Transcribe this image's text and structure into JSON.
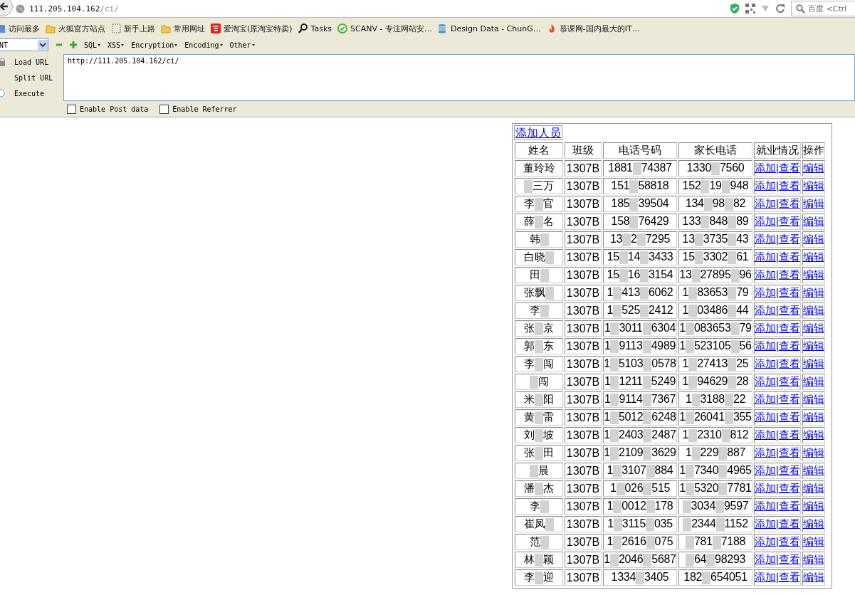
{
  "address_bar": {
    "host": "111.205.104.162",
    "path": "/ci/"
  },
  "search": {
    "placeholder": "百度 <Ctrl"
  },
  "bookmarks": [
    {
      "kind": "grid",
      "label": "访问最多"
    },
    {
      "kind": "folder",
      "label": "火狐官方站点"
    },
    {
      "kind": "dashed",
      "label": "新手上路"
    },
    {
      "kind": "folder",
      "label": "常用网址"
    },
    {
      "kind": "shop",
      "label": "爱淘宝(原淘宝特卖)"
    },
    {
      "kind": "magnifier",
      "label": "Tasks"
    },
    {
      "kind": "check",
      "label": "SCANV - 专注网站安…"
    },
    {
      "kind": "database",
      "label": "Design Data - ChunG…"
    },
    {
      "kind": "flame",
      "label": "慕课网-国内最大的IT…"
    }
  ],
  "hackbar": {
    "select_value": "NT",
    "menus": [
      "SQL",
      "XSS",
      "Encryption",
      "Encoding",
      "Other"
    ],
    "actions": [
      {
        "kind": "lock",
        "label": "Load URL"
      },
      {
        "kind": "plain",
        "label": "Split URL"
      },
      {
        "kind": "circle",
        "label": "Execute"
      }
    ],
    "url_value": "http://111.205.104.162/ci/",
    "options": [
      {
        "label": "Enable Post data",
        "checked": false
      },
      {
        "label": "Enable Referrer",
        "checked": false
      }
    ]
  },
  "page": {
    "add_link": "添加人员",
    "columns": [
      "姓名",
      "班级",
      "电话号码",
      "家长电话",
      "就业情况",
      "操作"
    ],
    "rows": [
      {
        "name": [
          {
            "kind": "text",
            "text": "董玲玲"
          }
        ],
        "class": "1307B",
        "phone": [
          {
            "kind": "text",
            "text": "1881"
          },
          {
            "kind": "mask"
          },
          {
            "kind": "text",
            "text": "74387"
          }
        ],
        "parent_phone": [
          {
            "kind": "text",
            "text": "1330"
          },
          {
            "kind": "mask"
          },
          {
            "kind": "text",
            "text": "7560"
          }
        ],
        "actions": [
          "添加",
          "|",
          "查看"
        ],
        "edit": "编辑"
      },
      {
        "name": [
          {
            "kind": "mask"
          },
          {
            "kind": "text",
            "text": "三万"
          }
        ],
        "class": "1307B",
        "phone": [
          {
            "kind": "text",
            "text": "151"
          },
          {
            "kind": "mask"
          },
          {
            "kind": "text",
            "text": "58818"
          }
        ],
        "parent_phone": [
          {
            "kind": "text",
            "text": "152"
          },
          {
            "kind": "mask"
          },
          {
            "kind": "text",
            "text": "19"
          },
          {
            "kind": "mask"
          },
          {
            "kind": "text",
            "text": "948"
          }
        ],
        "actions": [
          "添加",
          "|",
          "查看"
        ],
        "edit": "编辑"
      },
      {
        "name": [
          {
            "kind": "text",
            "text": "李"
          },
          {
            "kind": "mask"
          },
          {
            "kind": "text",
            "text": "官"
          }
        ],
        "class": "1307B",
        "phone": [
          {
            "kind": "text",
            "text": "185"
          },
          {
            "kind": "mask"
          },
          {
            "kind": "text",
            "text": "39504"
          }
        ],
        "parent_phone": [
          {
            "kind": "text",
            "text": "134"
          },
          {
            "kind": "mask"
          },
          {
            "kind": "text",
            "text": "98"
          },
          {
            "kind": "mask"
          },
          {
            "kind": "text",
            "text": "82"
          }
        ],
        "actions": [
          "添加",
          "|",
          "查看"
        ],
        "edit": "编辑"
      },
      {
        "name": [
          {
            "kind": "text",
            "text": "薛"
          },
          {
            "kind": "mask"
          },
          {
            "kind": "text",
            "text": "名"
          }
        ],
        "class": "1307B",
        "phone": [
          {
            "kind": "text",
            "text": "158"
          },
          {
            "kind": "mask"
          },
          {
            "kind": "text",
            "text": "76429"
          }
        ],
        "parent_phone": [
          {
            "kind": "text",
            "text": "133"
          },
          {
            "kind": "mask"
          },
          {
            "kind": "text",
            "text": "848"
          },
          {
            "kind": "mask"
          },
          {
            "kind": "text",
            "text": "89"
          }
        ],
        "actions": [
          "添加",
          "|",
          "查看"
        ],
        "edit": "编辑"
      },
      {
        "name": [
          {
            "kind": "text",
            "text": "韩"
          },
          {
            "kind": "mask"
          }
        ],
        "class": "1307B",
        "phone": [
          {
            "kind": "text",
            "text": "13"
          },
          {
            "kind": "mask"
          },
          {
            "kind": "text",
            "text": "2"
          },
          {
            "kind": "mask"
          },
          {
            "kind": "text",
            "text": "7295"
          }
        ],
        "parent_phone": [
          {
            "kind": "text",
            "text": "13"
          },
          {
            "kind": "mask"
          },
          {
            "kind": "text",
            "text": "3735"
          },
          {
            "kind": "mask"
          },
          {
            "kind": "text",
            "text": "43"
          }
        ],
        "actions": [
          "添加",
          "|",
          "查看"
        ],
        "edit": "编辑"
      },
      {
        "name": [
          {
            "kind": "text",
            "text": "白晓"
          },
          {
            "kind": "mask"
          }
        ],
        "class": "1307B",
        "phone": [
          {
            "kind": "text",
            "text": "15"
          },
          {
            "kind": "mask"
          },
          {
            "kind": "text",
            "text": "14"
          },
          {
            "kind": "mask"
          },
          {
            "kind": "text",
            "text": "3433"
          }
        ],
        "parent_phone": [
          {
            "kind": "text",
            "text": "15"
          },
          {
            "kind": "mask"
          },
          {
            "kind": "text",
            "text": "3302"
          },
          {
            "kind": "mask"
          },
          {
            "kind": "text",
            "text": "61"
          }
        ],
        "actions": [
          "添加",
          "|",
          "查看"
        ],
        "edit": "编辑"
      },
      {
        "name": [
          {
            "kind": "text",
            "text": "田"
          },
          {
            "kind": "mask"
          }
        ],
        "class": "1307B",
        "phone": [
          {
            "kind": "text",
            "text": "15"
          },
          {
            "kind": "mask"
          },
          {
            "kind": "text",
            "text": "16"
          },
          {
            "kind": "mask"
          },
          {
            "kind": "text",
            "text": "3154"
          }
        ],
        "parent_phone": [
          {
            "kind": "text",
            "text": "13"
          },
          {
            "kind": "mask"
          },
          {
            "kind": "text",
            "text": "27895"
          },
          {
            "kind": "mask"
          },
          {
            "kind": "text",
            "text": "96"
          }
        ],
        "actions": [
          "添加",
          "|",
          "查看"
        ],
        "edit": "编辑"
      },
      {
        "name": [
          {
            "kind": "text",
            "text": "张飘"
          },
          {
            "kind": "mask"
          }
        ],
        "class": "1307B",
        "phone": [
          {
            "kind": "text",
            "text": "1"
          },
          {
            "kind": "mask"
          },
          {
            "kind": "text",
            "text": "413"
          },
          {
            "kind": "mask"
          },
          {
            "kind": "text",
            "text": "6062"
          }
        ],
        "parent_phone": [
          {
            "kind": "text",
            "text": "1"
          },
          {
            "kind": "mask"
          },
          {
            "kind": "text",
            "text": "83653"
          },
          {
            "kind": "mask"
          },
          {
            "kind": "text",
            "text": "79"
          }
        ],
        "actions": [
          "添加",
          "|",
          "查看"
        ],
        "edit": "编辑"
      },
      {
        "name": [
          {
            "kind": "text",
            "text": "李"
          },
          {
            "kind": "mask"
          }
        ],
        "class": "1307B",
        "phone": [
          {
            "kind": "text",
            "text": "1"
          },
          {
            "kind": "mask"
          },
          {
            "kind": "text",
            "text": "525"
          },
          {
            "kind": "mask"
          },
          {
            "kind": "text",
            "text": "2412"
          }
        ],
        "parent_phone": [
          {
            "kind": "text",
            "text": "1"
          },
          {
            "kind": "mask"
          },
          {
            "kind": "text",
            "text": "03486"
          },
          {
            "kind": "mask"
          },
          {
            "kind": "text",
            "text": "44"
          }
        ],
        "actions": [
          "添加",
          "|",
          "查看"
        ],
        "edit": "编辑"
      },
      {
        "name": [
          {
            "kind": "text",
            "text": "张"
          },
          {
            "kind": "mask"
          },
          {
            "kind": "text",
            "text": "京"
          }
        ],
        "class": "1307B",
        "phone": [
          {
            "kind": "text",
            "text": "1"
          },
          {
            "kind": "mask"
          },
          {
            "kind": "text",
            "text": "3011"
          },
          {
            "kind": "mask"
          },
          {
            "kind": "text",
            "text": "6304"
          }
        ],
        "parent_phone": [
          {
            "kind": "text",
            "text": "1"
          },
          {
            "kind": "mask"
          },
          {
            "kind": "text",
            "text": "083653"
          },
          {
            "kind": "mask"
          },
          {
            "kind": "text",
            "text": "79"
          }
        ],
        "actions": [
          "添加",
          "|",
          "查看"
        ],
        "edit": "编辑"
      },
      {
        "name": [
          {
            "kind": "text",
            "text": "郭"
          },
          {
            "kind": "mask"
          },
          {
            "kind": "text",
            "text": "东"
          }
        ],
        "class": "1307B",
        "phone": [
          {
            "kind": "text",
            "text": "1"
          },
          {
            "kind": "mask"
          },
          {
            "kind": "text",
            "text": "9113"
          },
          {
            "kind": "mask"
          },
          {
            "kind": "text",
            "text": "4989"
          }
        ],
        "parent_phone": [
          {
            "kind": "text",
            "text": "1"
          },
          {
            "kind": "mask"
          },
          {
            "kind": "text",
            "text": "523105"
          },
          {
            "kind": "mask"
          },
          {
            "kind": "text",
            "text": "56"
          }
        ],
        "actions": [
          "添加",
          "|",
          "查看"
        ],
        "edit": "编辑"
      },
      {
        "name": [
          {
            "kind": "text",
            "text": "李"
          },
          {
            "kind": "mask"
          },
          {
            "kind": "text",
            "text": "闯"
          }
        ],
        "class": "1307B",
        "phone": [
          {
            "kind": "text",
            "text": "1"
          },
          {
            "kind": "mask"
          },
          {
            "kind": "text",
            "text": "5103"
          },
          {
            "kind": "mask"
          },
          {
            "kind": "text",
            "text": "0578"
          }
        ],
        "parent_phone": [
          {
            "kind": "text",
            "text": "1"
          },
          {
            "kind": "mask"
          },
          {
            "kind": "text",
            "text": "27413"
          },
          {
            "kind": "mask"
          },
          {
            "kind": "text",
            "text": "25"
          }
        ],
        "actions": [
          "添加",
          "|",
          "查看"
        ],
        "edit": "编辑"
      },
      {
        "name": [
          {
            "kind": "mask"
          },
          {
            "kind": "text",
            "text": "闯"
          }
        ],
        "class": "1307B",
        "phone": [
          {
            "kind": "text",
            "text": "1"
          },
          {
            "kind": "mask"
          },
          {
            "kind": "text",
            "text": "1211"
          },
          {
            "kind": "mask"
          },
          {
            "kind": "text",
            "text": "5249"
          }
        ],
        "parent_phone": [
          {
            "kind": "text",
            "text": "1"
          },
          {
            "kind": "mask"
          },
          {
            "kind": "text",
            "text": "94629"
          },
          {
            "kind": "mask"
          },
          {
            "kind": "text",
            "text": "28"
          }
        ],
        "actions": [
          "添加",
          "|",
          "查看"
        ],
        "edit": "编辑"
      },
      {
        "name": [
          {
            "kind": "text",
            "text": "米"
          },
          {
            "kind": "mask"
          },
          {
            "kind": "text",
            "text": "阳"
          }
        ],
        "class": "1307B",
        "phone": [
          {
            "kind": "text",
            "text": "1"
          },
          {
            "kind": "mask"
          },
          {
            "kind": "text",
            "text": "9114"
          },
          {
            "kind": "mask"
          },
          {
            "kind": "text",
            "text": "7367"
          }
        ],
        "parent_phone": [
          {
            "kind": "text",
            "text": "1"
          },
          {
            "kind": "mask"
          },
          {
            "kind": "text",
            "text": "3188"
          },
          {
            "kind": "mask"
          },
          {
            "kind": "text",
            "text": "22"
          }
        ],
        "actions": [
          "添加",
          "|",
          "查看"
        ],
        "edit": "编辑"
      },
      {
        "name": [
          {
            "kind": "text",
            "text": "黄"
          },
          {
            "kind": "mask"
          },
          {
            "kind": "text",
            "text": "雷"
          }
        ],
        "class": "1307B",
        "phone": [
          {
            "kind": "text",
            "text": "1"
          },
          {
            "kind": "mask"
          },
          {
            "kind": "text",
            "text": "5012"
          },
          {
            "kind": "mask"
          },
          {
            "kind": "text",
            "text": "6248"
          }
        ],
        "parent_phone": [
          {
            "kind": "text",
            "text": "1"
          },
          {
            "kind": "mask"
          },
          {
            "kind": "text",
            "text": "26041"
          },
          {
            "kind": "mask"
          },
          {
            "kind": "text",
            "text": "355"
          }
        ],
        "actions": [
          "添加",
          "|",
          "查看"
        ],
        "edit": "编辑"
      },
      {
        "name": [
          {
            "kind": "text",
            "text": "刘"
          },
          {
            "kind": "mask"
          },
          {
            "kind": "text",
            "text": "坡"
          }
        ],
        "class": "1307B",
        "phone": [
          {
            "kind": "text",
            "text": "1"
          },
          {
            "kind": "mask"
          },
          {
            "kind": "text",
            "text": "2403"
          },
          {
            "kind": "mask"
          },
          {
            "kind": "text",
            "text": "2487"
          }
        ],
        "parent_phone": [
          {
            "kind": "text",
            "text": "1"
          },
          {
            "kind": "mask"
          },
          {
            "kind": "text",
            "text": "2310"
          },
          {
            "kind": "mask"
          },
          {
            "kind": "text",
            "text": "812"
          }
        ],
        "actions": [
          "添加",
          "|",
          "查看"
        ],
        "edit": "编辑"
      },
      {
        "name": [
          {
            "kind": "text",
            "text": "张"
          },
          {
            "kind": "mask"
          },
          {
            "kind": "text",
            "text": "田"
          }
        ],
        "class": "1307B",
        "phone": [
          {
            "kind": "text",
            "text": "1"
          },
          {
            "kind": "mask"
          },
          {
            "kind": "text",
            "text": "2109"
          },
          {
            "kind": "mask"
          },
          {
            "kind": "text",
            "text": "3629"
          }
        ],
        "parent_phone": [
          {
            "kind": "text",
            "text": "1"
          },
          {
            "kind": "mask"
          },
          {
            "kind": "text",
            "text": "229"
          },
          {
            "kind": "mask"
          },
          {
            "kind": "text",
            "text": "887"
          }
        ],
        "actions": [
          "添加",
          "|",
          "查看"
        ],
        "edit": "编辑"
      },
      {
        "name": [
          {
            "kind": "mask"
          },
          {
            "kind": "text",
            "text": "晨"
          }
        ],
        "class": "1307B",
        "phone": [
          {
            "kind": "text",
            "text": "1"
          },
          {
            "kind": "mask"
          },
          {
            "kind": "text",
            "text": "3107"
          },
          {
            "kind": "mask"
          },
          {
            "kind": "text",
            "text": "884"
          }
        ],
        "parent_phone": [
          {
            "kind": "text",
            "text": "1"
          },
          {
            "kind": "mask"
          },
          {
            "kind": "text",
            "text": "7340"
          },
          {
            "kind": "mask"
          },
          {
            "kind": "text",
            "text": "4965"
          }
        ],
        "actions": [
          "添加",
          "|",
          "查看"
        ],
        "edit": "编辑"
      },
      {
        "name": [
          {
            "kind": "text",
            "text": "潘"
          },
          {
            "kind": "mask"
          },
          {
            "kind": "text",
            "text": "杰"
          }
        ],
        "class": "1307B",
        "phone": [
          {
            "kind": "text",
            "text": "1"
          },
          {
            "kind": "mask"
          },
          {
            "kind": "text",
            "text": "026"
          },
          {
            "kind": "mask"
          },
          {
            "kind": "text",
            "text": "515"
          }
        ],
        "parent_phone": [
          {
            "kind": "text",
            "text": "1"
          },
          {
            "kind": "mask"
          },
          {
            "kind": "text",
            "text": "5320"
          },
          {
            "kind": "mask"
          },
          {
            "kind": "text",
            "text": "7781"
          }
        ],
        "actions": [
          "添加",
          "|",
          "查看"
        ],
        "edit": "编辑"
      },
      {
        "name": [
          {
            "kind": "text",
            "text": "李"
          },
          {
            "kind": "mask"
          }
        ],
        "class": "1307B",
        "phone": [
          {
            "kind": "text",
            "text": "1"
          },
          {
            "kind": "mask"
          },
          {
            "kind": "text",
            "text": "0012"
          },
          {
            "kind": "mask"
          },
          {
            "kind": "text",
            "text": "178"
          }
        ],
        "parent_phone": [
          {
            "kind": "mask"
          },
          {
            "kind": "text",
            "text": "3034"
          },
          {
            "kind": "mask"
          },
          {
            "kind": "text",
            "text": "9597"
          }
        ],
        "actions": [
          "添加",
          "|",
          "查看"
        ],
        "edit": "编辑"
      },
      {
        "name": [
          {
            "kind": "text",
            "text": "崔凤"
          },
          {
            "kind": "mask"
          }
        ],
        "class": "1307B",
        "phone": [
          {
            "kind": "text",
            "text": "1"
          },
          {
            "kind": "mask"
          },
          {
            "kind": "text",
            "text": "3115"
          },
          {
            "kind": "mask"
          },
          {
            "kind": "text",
            "text": "035"
          }
        ],
        "parent_phone": [
          {
            "kind": "mask"
          },
          {
            "kind": "text",
            "text": "2344"
          },
          {
            "kind": "mask"
          },
          {
            "kind": "text",
            "text": "1152"
          }
        ],
        "actions": [
          "添加",
          "|",
          "查看"
        ],
        "edit": "编辑"
      },
      {
        "name": [
          {
            "kind": "text",
            "text": "范"
          },
          {
            "kind": "mask"
          }
        ],
        "class": "1307B",
        "phone": [
          {
            "kind": "text",
            "text": "1"
          },
          {
            "kind": "mask"
          },
          {
            "kind": "text",
            "text": "2616"
          },
          {
            "kind": "mask"
          },
          {
            "kind": "text",
            "text": "075"
          }
        ],
        "parent_phone": [
          {
            "kind": "mask"
          },
          {
            "kind": "text",
            "text": "781"
          },
          {
            "kind": "mask"
          },
          {
            "kind": "text",
            "text": "7188"
          }
        ],
        "actions": [
          "添加",
          "|",
          "查看"
        ],
        "edit": "编辑"
      },
      {
        "name": [
          {
            "kind": "text",
            "text": "林"
          },
          {
            "kind": "mask"
          },
          {
            "kind": "text",
            "text": "颖"
          }
        ],
        "class": "1307B",
        "phone": [
          {
            "kind": "text",
            "text": "1"
          },
          {
            "kind": "mask"
          },
          {
            "kind": "text",
            "text": "2046"
          },
          {
            "kind": "mask"
          },
          {
            "kind": "text",
            "text": "5687"
          }
        ],
        "parent_phone": [
          {
            "kind": "mask"
          },
          {
            "kind": "text",
            "text": "64"
          },
          {
            "kind": "mask"
          },
          {
            "kind": "text",
            "text": "98293"
          }
        ],
        "actions": [
          "添加",
          "|",
          "查看"
        ],
        "edit": "编辑"
      },
      {
        "name": [
          {
            "kind": "text",
            "text": "李"
          },
          {
            "kind": "mask"
          },
          {
            "kind": "text",
            "text": "迎"
          }
        ],
        "class": "1307B",
        "phone": [
          {
            "kind": "text",
            "text": "1334"
          },
          {
            "kind": "mask"
          },
          {
            "kind": "text",
            "text": "3405"
          }
        ],
        "parent_phone": [
          {
            "kind": "text",
            "text": "182"
          },
          {
            "kind": "mask"
          },
          {
            "kind": "text",
            "text": "654051"
          }
        ],
        "actions": [
          "添加",
          "|",
          "查看"
        ],
        "edit": "编辑"
      }
    ]
  }
}
